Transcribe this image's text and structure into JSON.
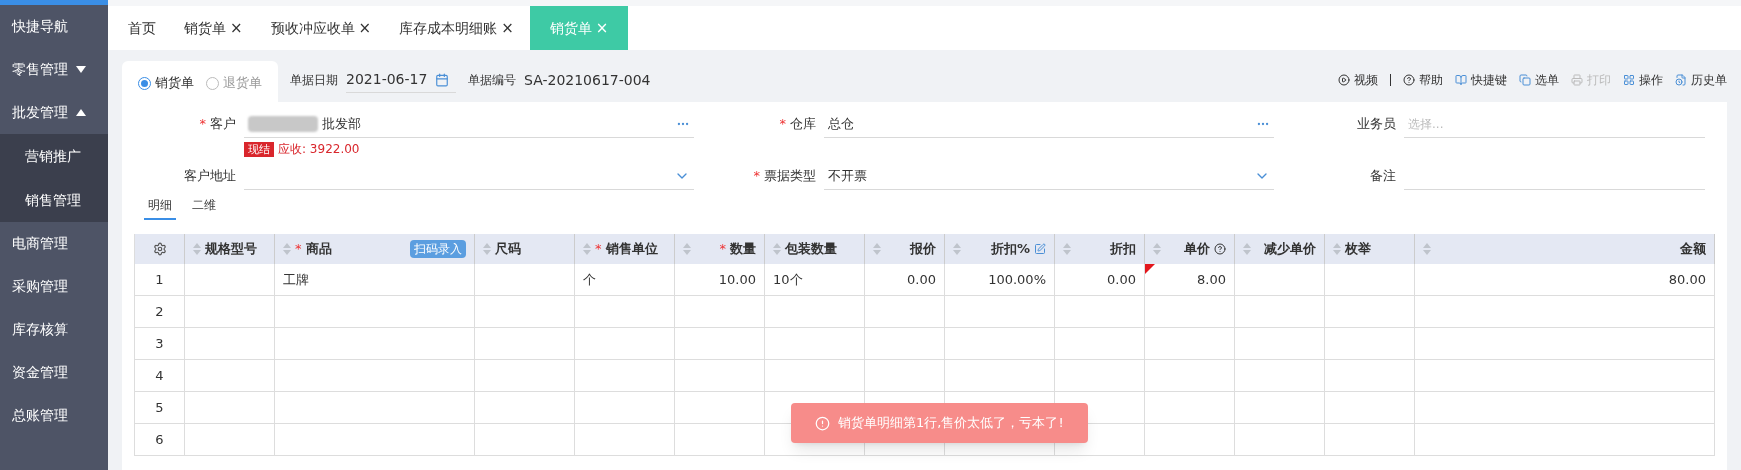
{
  "sidebar": {
    "items": [
      {
        "label": "快捷导航"
      },
      {
        "label": "零售管理",
        "expanded": false
      },
      {
        "label": "批发管理",
        "expanded": true,
        "children": [
          {
            "label": "营销推广"
          },
          {
            "label": "销售管理"
          }
        ]
      },
      {
        "label": "电商管理"
      },
      {
        "label": "采购管理"
      },
      {
        "label": "库存核算"
      },
      {
        "label": "资金管理"
      },
      {
        "label": "总账管理"
      }
    ]
  },
  "tabs": [
    {
      "label": "首页",
      "selected": false
    },
    {
      "label": "销货单",
      "close": "×",
      "selected": false
    },
    {
      "label": "预收冲应收单",
      "close": "×",
      "selected": false
    },
    {
      "label": "库存成本明细账",
      "close": "×",
      "selected": false
    },
    {
      "label": "销货单",
      "close": "×",
      "selected": true
    }
  ],
  "doc_type": [
    {
      "label": "销货单",
      "selected": true
    },
    {
      "label": "退货单",
      "selected": false
    }
  ],
  "doc_date": {
    "label": "单据日期",
    "value": "2021-06-17"
  },
  "doc_number": {
    "label": "单据编号",
    "value": "SA-20210617-004"
  },
  "toolbar": [
    {
      "label": "视频",
      "disabled": false
    },
    {
      "label": "帮助",
      "disabled": false
    },
    {
      "label": "快捷键",
      "disabled": false
    },
    {
      "label": "选单",
      "disabled": false
    },
    {
      "label": "打印",
      "disabled": true
    },
    {
      "label": "操作",
      "disabled": false
    },
    {
      "label": "历史单",
      "disabled": false
    }
  ],
  "fields": [
    {
      "label": "客户",
      "required": "*",
      "kind": "lookup",
      "value": "批发部",
      "blurred_prefix": true,
      "badge": "现结",
      "note": "应收: 3922.00"
    },
    {
      "label": "仓库",
      "required": "*",
      "kind": "lookup",
      "value": "总仓"
    },
    {
      "label": "业务员",
      "kind": "text",
      "placeholder": "选择..."
    },
    {
      "label": "客户地址",
      "kind": "select"
    },
    {
      "label": "票据类型",
      "required": "*",
      "kind": "select",
      "value": "不开票"
    },
    {
      "label": "备注",
      "kind": "text"
    }
  ],
  "subtabs": [
    {
      "label": "明细",
      "selected": true
    },
    {
      "label": "二维",
      "selected": false
    }
  ],
  "table": {
    "scan_button": "扫码录入",
    "columns": [
      {
        "label": "规格型号"
      },
      {
        "label": "商品",
        "required": "*"
      },
      {
        "label": "尺码"
      },
      {
        "label": "销售单位",
        "required": "*"
      },
      {
        "label": "数量",
        "required": "*"
      },
      {
        "label": "包装数量"
      },
      {
        "label": "报价"
      },
      {
        "label": "折扣%"
      },
      {
        "label": "折扣"
      },
      {
        "label": "单价"
      },
      {
        "label": "减少单价"
      },
      {
        "label": "枚举"
      },
      {
        "label": "金额"
      }
    ],
    "rows": [
      {
        "number": "1",
        "cells": [
          null,
          "工牌",
          null,
          "个",
          "10.00",
          "10个",
          "0.00",
          "100.00%",
          "0.00",
          "8.00",
          null,
          null,
          "80.00"
        ],
        "flagged": true
      },
      {
        "number": "2",
        "flagged": false
      },
      {
        "number": "3",
        "flagged": false
      },
      {
        "number": "4",
        "flagged": false
      },
      {
        "number": "5",
        "flagged": false
      },
      {
        "number": "6",
        "flagged": false
      }
    ]
  },
  "toast": {
    "message": "销货单明细第1行,售价太低了，亏本了!"
  }
}
